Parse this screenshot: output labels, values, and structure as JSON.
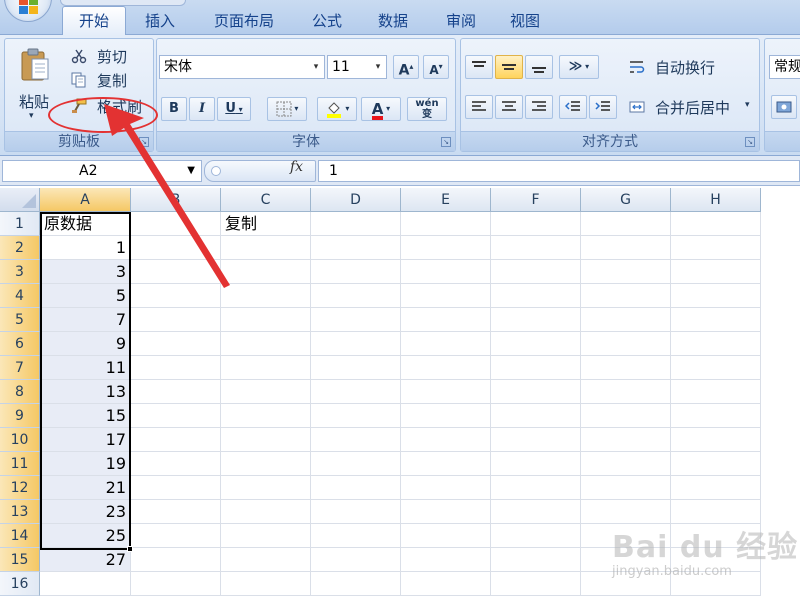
{
  "ribbon": {
    "tabs": [
      "开始",
      "插入",
      "页面布局",
      "公式",
      "数据",
      "审阅",
      "视图"
    ],
    "active_tab": "开始",
    "clipboard": {
      "paste": "粘贴",
      "cut": "剪切",
      "copy": "复制",
      "format_painter": "格式刷",
      "group_label": "剪贴板"
    },
    "font": {
      "font_name": "宋体",
      "font_size": "11",
      "bold": "B",
      "italic": "I",
      "underline": "U",
      "font_color_glyph": "A",
      "group_label": "字体"
    },
    "alignment": {
      "wrap_text": "自动换行",
      "merge_center": "合并后居中",
      "group_label": "对齐方式"
    },
    "number": {
      "format": "常规"
    }
  },
  "formula_bar": {
    "name_box": "A2",
    "fx": "fx",
    "value": "1"
  },
  "sheet": {
    "columns": [
      "A",
      "B",
      "C",
      "D",
      "E",
      "F",
      "G",
      "H"
    ],
    "rows": [
      "1",
      "2",
      "3",
      "4",
      "5",
      "6",
      "7",
      "8",
      "9",
      "10",
      "11",
      "12",
      "13",
      "14",
      "15",
      "16"
    ],
    "A1": "原数据",
    "C1": "复制",
    "column_a_values": [
      "1",
      "3",
      "5",
      "7",
      "9",
      "11",
      "13",
      "15",
      "17",
      "19",
      "21",
      "23",
      "25",
      "27"
    ]
  },
  "watermark": {
    "main": "Bai du 经验",
    "sub": "jingyan.baidu.com"
  },
  "colors": {
    "annotation": "#e33232",
    "selection_header": "#f5c865",
    "ribbon_text": "#15428b"
  }
}
